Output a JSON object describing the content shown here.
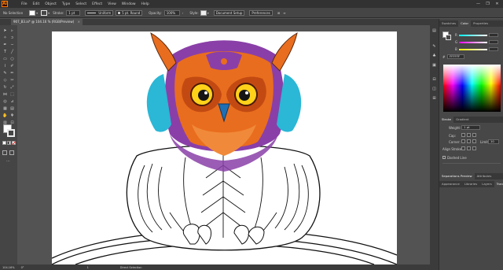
{
  "app": {
    "logo": "Ai"
  },
  "menu": [
    "File",
    "Edit",
    "Object",
    "Type",
    "Select",
    "Effect",
    "View",
    "Window",
    "Help"
  ],
  "window_controls": {
    "minimize": "—",
    "maximize": "❐",
    "close": "✕"
  },
  "control_bar": {
    "selection": "No Selection",
    "stroke_label": "Stroke:",
    "stroke_weight": "1 pt",
    "stroke_profile": "Uniform",
    "brush": "5 pt. Round",
    "opacity_label": "Opacity:",
    "opacity_value": "100%",
    "style_label": "Style:",
    "document_setup": "Document Setup",
    "preferences": "Preferences"
  },
  "document_tab": {
    "title": "907_B3.ai* @ 104.16 % (RGB/Preview)",
    "close": "×"
  },
  "status_bar": {
    "zoom": "104.16%",
    "angle": "0°",
    "artboard": "1",
    "tool": "Direct Selection"
  },
  "panels": {
    "top_tabs": [
      "Swatches",
      "Color",
      "Properties"
    ],
    "active_top_tab": "Color",
    "color_sliders": [
      {
        "label": "R",
        "color": "#ff4040"
      },
      {
        "label": "G",
        "color": "#40c040"
      },
      {
        "label": "B",
        "color": "#4060ff"
      }
    ],
    "color_hex_prefix": "#",
    "color_hex": "FFFFFF",
    "stroke_tabs": [
      "Stroke",
      "Gradient"
    ],
    "weight_label": "Weight:",
    "weight_value": "1 pt",
    "cap_label": "Cap:",
    "corner_label": "Corner:",
    "limit_label": "Limit:",
    "limit_value": "10",
    "align_label": "Align Stroke:",
    "dashed_label": "Dashed Line",
    "sep_tabs": [
      "Separations Preview",
      "Attributes"
    ],
    "bottom_tabs": [
      "Appearance",
      "Libraries",
      "Layers",
      "Transparency"
    ],
    "active_bottom_tab": "Transparency"
  },
  "colors": {
    "owl_orange": "#e96d1e",
    "owl_purple": "#8a3fa8",
    "owl_cyan": "#2bb7d6",
    "eye_yellow": "#ffd21a",
    "beak_blue": "#1f6fb4"
  }
}
